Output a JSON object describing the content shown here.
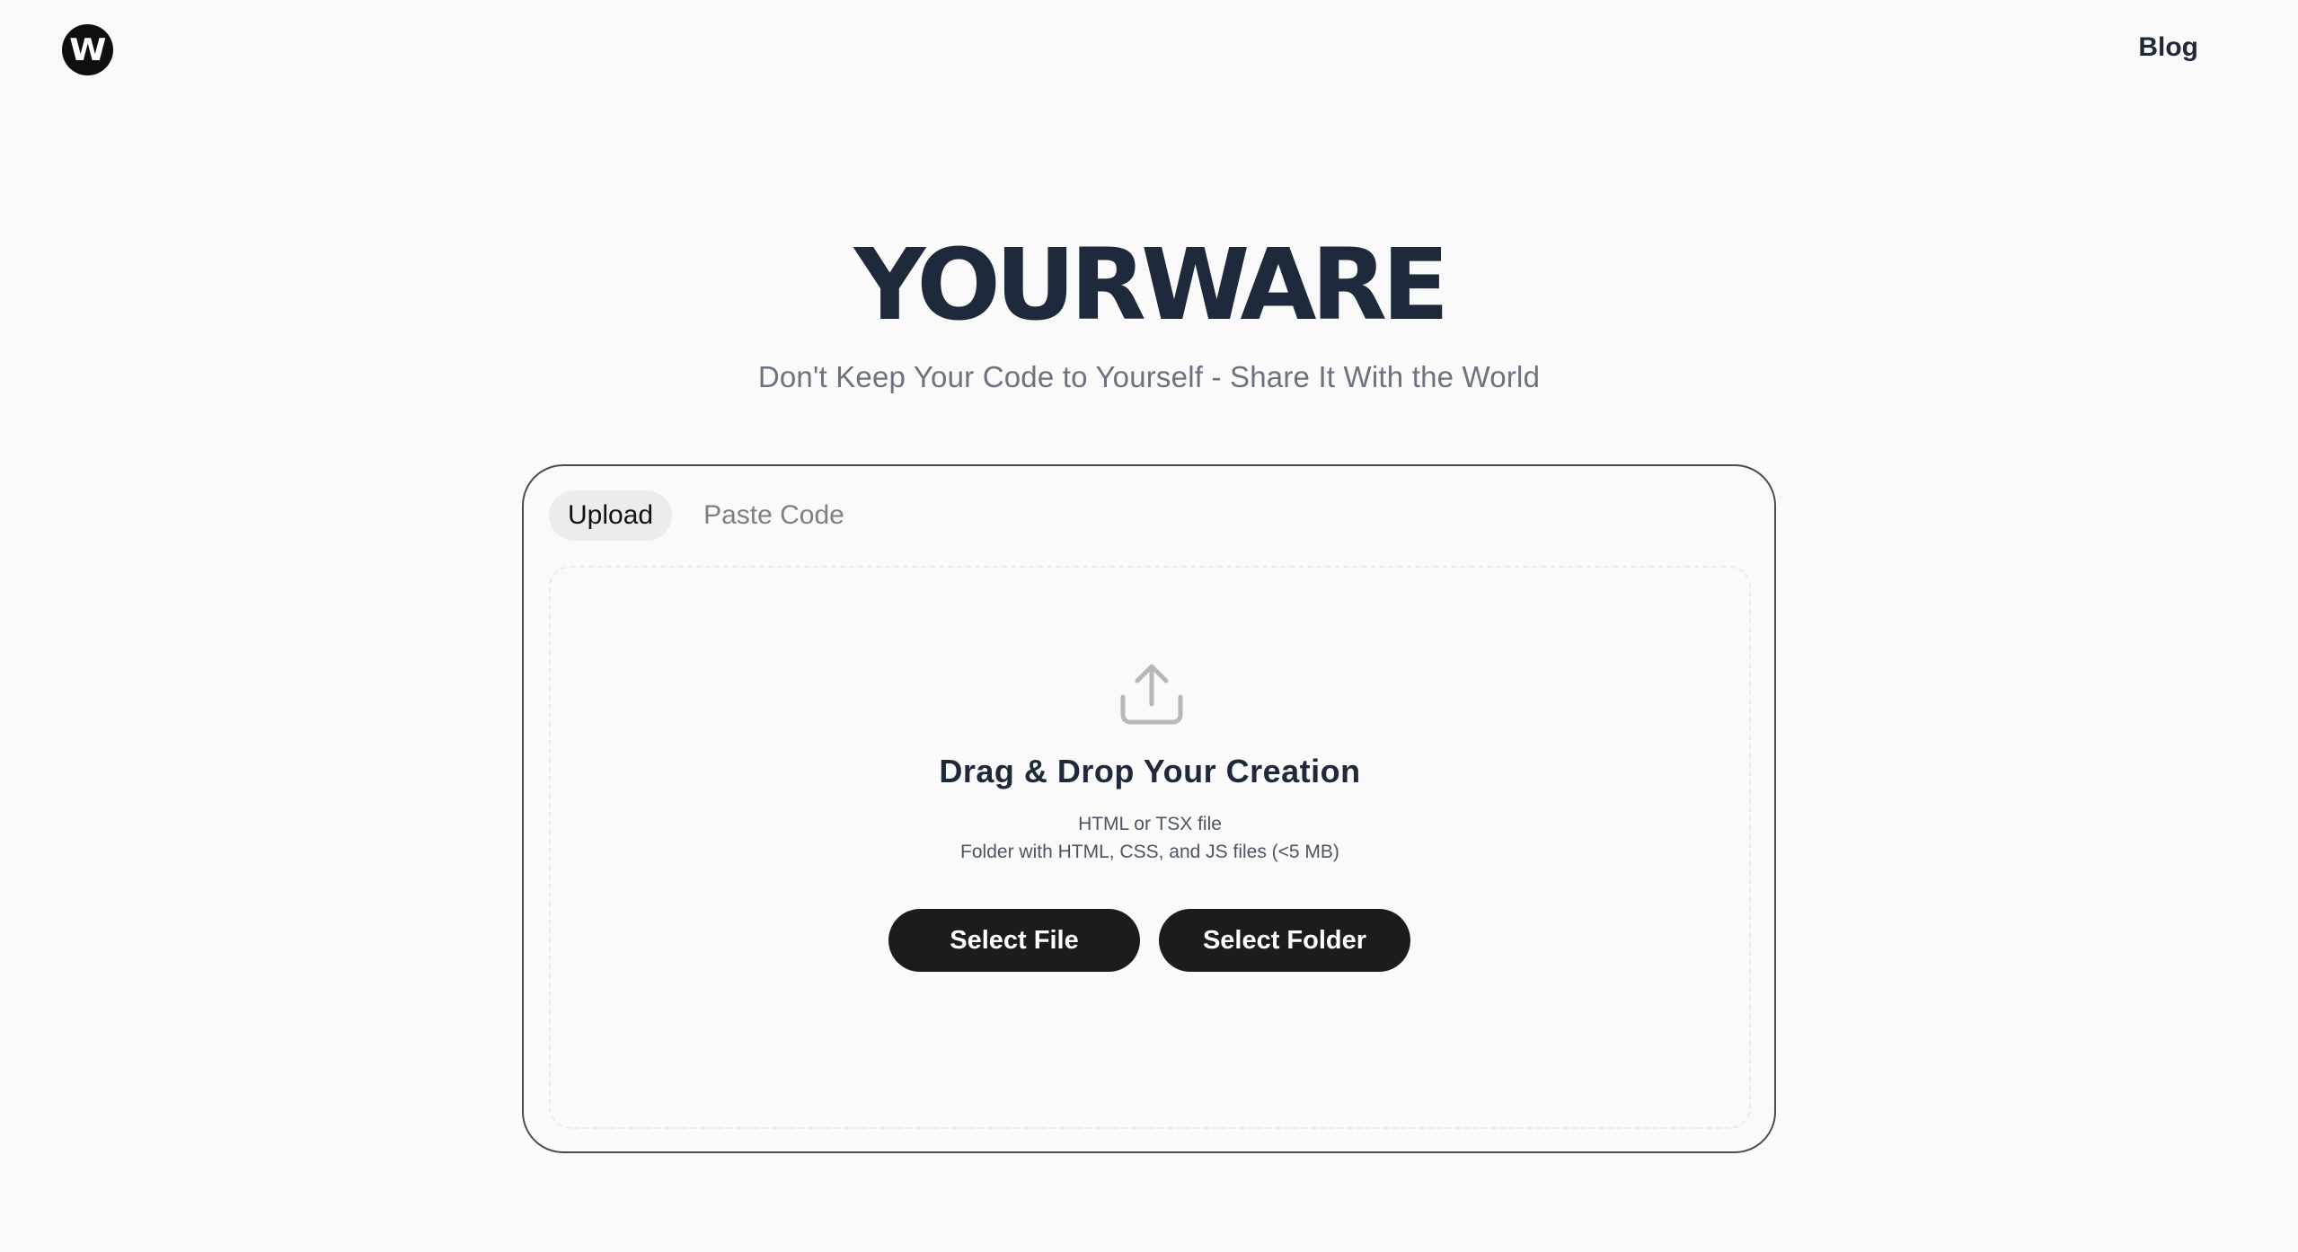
{
  "header": {
    "logo_letter": "W",
    "blog_label": "Blog"
  },
  "hero": {
    "title": "YOURWARE",
    "subtitle": "Don't Keep Your Code to Yourself - Share It With the World"
  },
  "card": {
    "tabs": [
      {
        "label": "Upload",
        "active": true
      },
      {
        "label": "Paste Code",
        "active": false
      }
    ],
    "dropzone": {
      "icon": "upload-icon",
      "title": "Drag & Drop Your Creation",
      "hint_line_1": "HTML or TSX file",
      "hint_line_2": "Folder with HTML, CSS, and JS files (<5 MB)"
    },
    "buttons": {
      "select_file": "Select File",
      "select_folder": "Select Folder"
    }
  },
  "colors": {
    "background": "#fafafa",
    "button": "#1c1c1c",
    "title": "#1e293b",
    "muted": "#6b7280"
  }
}
